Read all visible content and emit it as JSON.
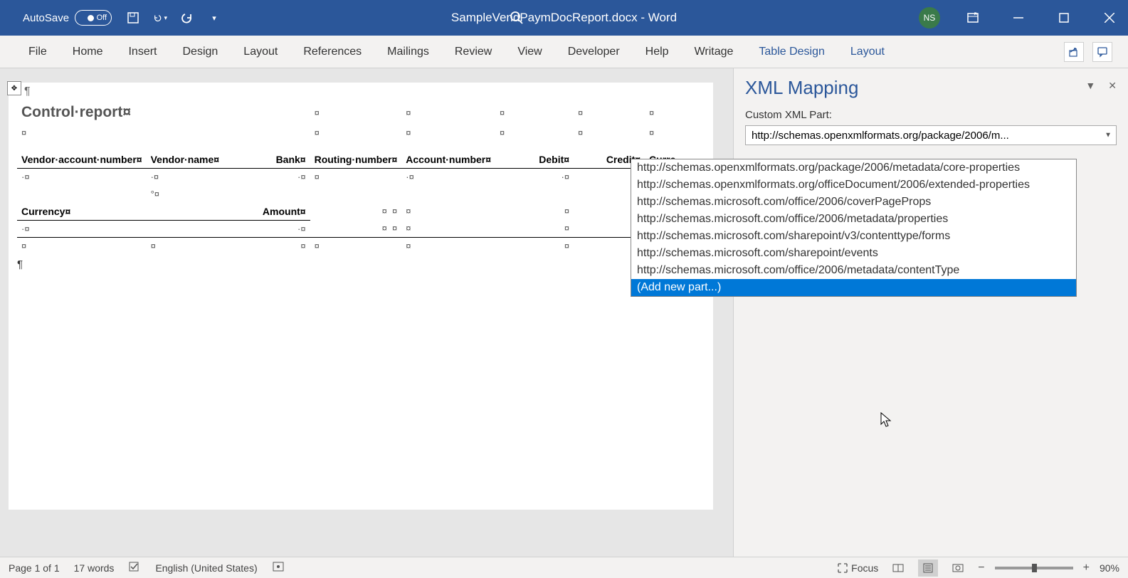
{
  "titleBar": {
    "autosave": "AutoSave",
    "autosaveState": "Off",
    "filename": "SampleVendPaymDocReport.docx  -  Word",
    "userInitials": "NS"
  },
  "ribbon": {
    "tabs": [
      "File",
      "Home",
      "Insert",
      "Design",
      "Layout",
      "References",
      "Mailings",
      "Review",
      "View",
      "Developer",
      "Help",
      "Writage"
    ],
    "contextTabs": [
      "Table Design",
      "Layout"
    ]
  },
  "document": {
    "title": "Control·report¤",
    "headers1": [
      "Vendor·account·number¤",
      "Vendor·name¤",
      "Bank¤",
      "Routing·number¤",
      "Account·number¤",
      "Debit¤",
      "Credit¤",
      "Curre"
    ],
    "headers2": [
      "Currency¤",
      "Amount¤"
    ]
  },
  "pane": {
    "title": "XML Mapping",
    "label": "Custom XML Part:",
    "selectValue": "http://schemas.openxmlformats.org/package/2006/m..."
  },
  "dropdown": {
    "items": [
      "http://schemas.openxmlformats.org/package/2006/metadata/core-properties",
      "http://schemas.openxmlformats.org/officeDocument/2006/extended-properties",
      "http://schemas.microsoft.com/office/2006/coverPageProps",
      "http://schemas.microsoft.com/office/2006/metadata/properties",
      "http://schemas.microsoft.com/sharepoint/v3/contenttype/forms",
      "http://schemas.microsoft.com/sharepoint/events",
      "http://schemas.microsoft.com/office/2006/metadata/contentType",
      "(Add new part...)"
    ],
    "highlightIndex": 7
  },
  "statusBar": {
    "page": "Page 1 of 1",
    "words": "17 words",
    "language": "English (United States)",
    "focus": "Focus",
    "zoom": "90%"
  }
}
